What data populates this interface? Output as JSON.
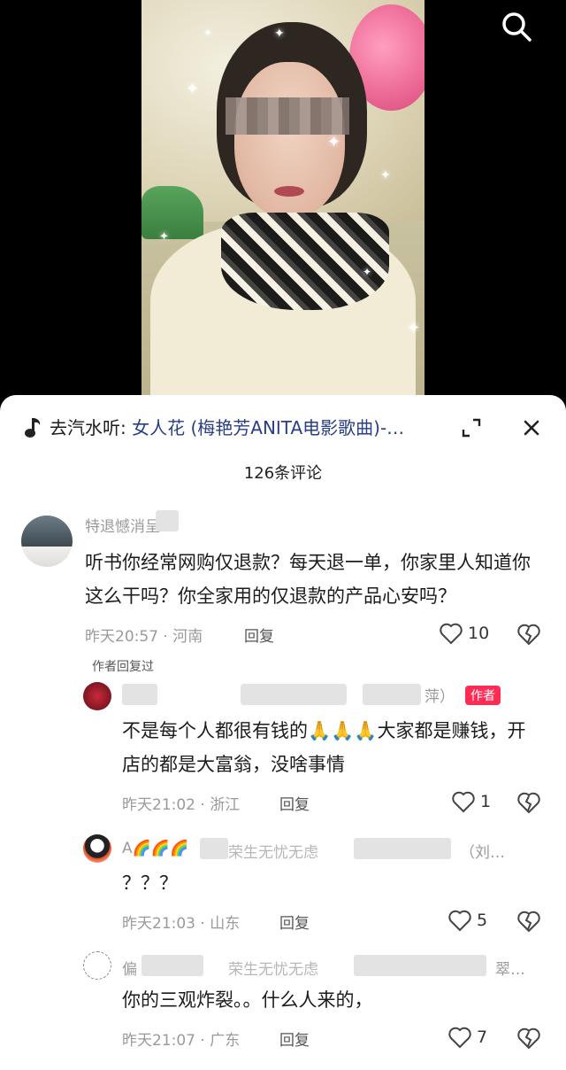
{
  "video": {
    "search_icon": "search-icon"
  },
  "music": {
    "icon": "music-note-icon",
    "source_label": "去汽水听: ",
    "song": "女人花 (梅艳芳ANITA电影歌曲)-…"
  },
  "sheet": {
    "expand_icon": "expand-icon",
    "close_icon": "close-icon",
    "comment_count": "126条评论"
  },
  "comments": [
    {
      "username": "特退憾消呈",
      "text": "听书你经常网购仅退款？每天退一单，你家里人知道你这么干吗？你全家用的仅退款的产品心安吗？",
      "time": "昨天20:57",
      "location": "河南",
      "reply_label": "回复",
      "likes": "10",
      "author_replied": "作者回复过"
    },
    {
      "username": "萍）",
      "badge": "作者",
      "text_before": "不是每个人都很有钱的",
      "emoji": "🙏🙏🙏",
      "text_after": "大家都是赚钱，开店的都是大富翁，没啥事情",
      "time": "昨天21:02",
      "location": "浙江",
      "reply_label": "回复",
      "likes": "1"
    },
    {
      "username": "A🌈🌈🌈",
      "username_tail": "荣生无忧无虑",
      "username_end": "（刘…",
      "text": "？？？",
      "time": "昨天21:03",
      "location": "山东",
      "reply_label": "回复",
      "likes": "5"
    },
    {
      "username": "偏",
      "username_tail": "荣生无忧无虑",
      "username_end": "翠…",
      "text": "你的三观炸裂。。什么人来的，",
      "time": "昨天21:07",
      "location": "广东",
      "reply_label": "回复",
      "likes": "7"
    }
  ],
  "colors": {
    "accent": "#fe2c55",
    "song_link": "#2a3e86",
    "meta_gray": "#9a9a9a"
  }
}
